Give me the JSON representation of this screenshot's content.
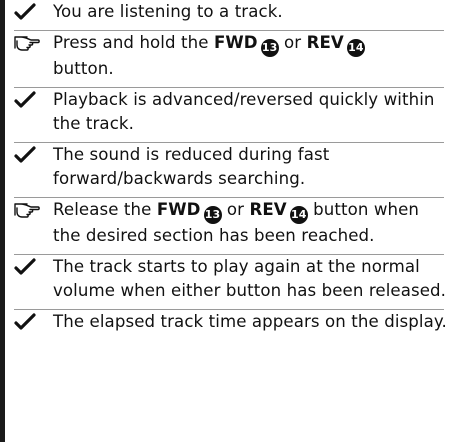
{
  "items": [
    {
      "type": "check",
      "text": "You are listening to a track."
    },
    {
      "type": "action",
      "pre": "Press and hold the ",
      "btn1": "FWD",
      "num1": "13",
      "mid": " or ",
      "btn2": "REV",
      "num2": "14",
      "post": " button."
    },
    {
      "type": "check",
      "text": "Playback is advanced/reversed quickly within the track."
    },
    {
      "type": "check",
      "text": "The sound is reduced during fast forward/backwards searching."
    },
    {
      "type": "action",
      "pre": "Release the ",
      "btn1": "FWD",
      "num1": "13",
      "mid": " or ",
      "btn2": "REV",
      "num2": "14",
      "post": " button when the desired section has been reached."
    },
    {
      "type": "check",
      "text": "The track starts to play again at the normal volume when either button has been released."
    },
    {
      "type": "check",
      "text": "The elapsed track time appears on the display."
    }
  ]
}
